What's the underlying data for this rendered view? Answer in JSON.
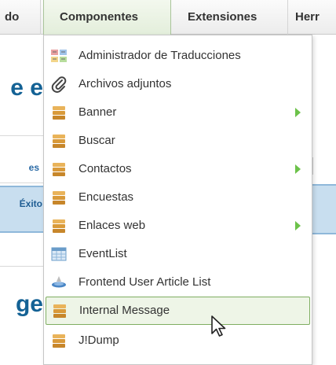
{
  "menubar": {
    "items": [
      {
        "label": "do"
      },
      {
        "label": "Componentes"
      },
      {
        "label": "Extensiones"
      },
      {
        "label": "Herr"
      }
    ]
  },
  "background": {
    "heading_1": "e e",
    "tab_label": "es",
    "success_text": "Éxito",
    "heading_2": "ge"
  },
  "dropdown": {
    "items": [
      {
        "label": "Administrador de Traducciones",
        "icon": "translations-icon",
        "submenu": false
      },
      {
        "label": "Archivos adjuntos",
        "icon": "paperclip-icon",
        "submenu": false
      },
      {
        "label": "Banner",
        "icon": "component-icon",
        "submenu": true
      },
      {
        "label": "Buscar",
        "icon": "component-icon",
        "submenu": false
      },
      {
        "label": "Contactos",
        "icon": "component-icon",
        "submenu": true
      },
      {
        "label": "Encuestas",
        "icon": "component-icon",
        "submenu": false
      },
      {
        "label": "Enlaces web",
        "icon": "component-icon",
        "submenu": true
      },
      {
        "label": "EventList",
        "icon": "calendar-icon",
        "submenu": false
      },
      {
        "label": "Frontend User Article List",
        "icon": "article-list-icon",
        "submenu": false
      },
      {
        "label": "Internal Message",
        "icon": "component-icon",
        "submenu": false,
        "highlighted": true
      },
      {
        "label": "J!Dump",
        "icon": "component-icon",
        "submenu": false
      }
    ]
  },
  "colors": {
    "highlight_border": "#7fae62",
    "submenu_arrow": "#6cc24a",
    "heading_blue": "#146295"
  }
}
